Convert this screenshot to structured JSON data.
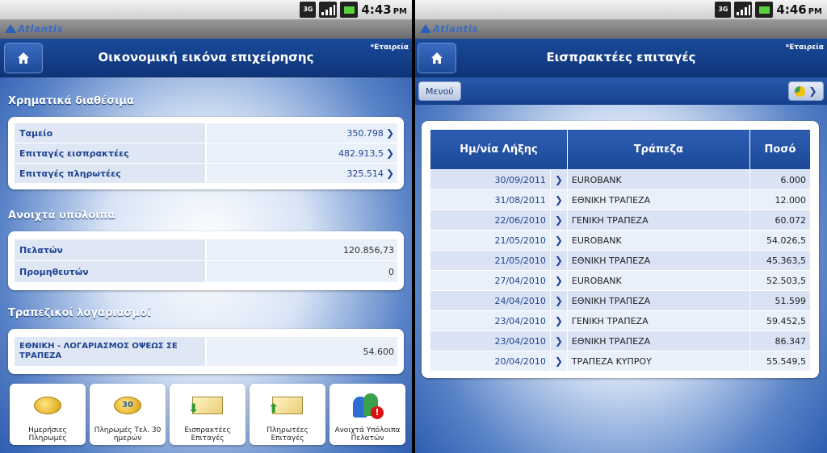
{
  "left": {
    "status": {
      "network": "3G",
      "time": "4:43",
      "ampm": "PM"
    },
    "logo": "Atlantis",
    "title": "Οικονομική εικόνα επιχείρησης",
    "company": "*Εταιρεία",
    "sections": {
      "cash": {
        "title": "Χρηματικά διαθέσιμα",
        "rows": [
          {
            "label": "Ταμείο",
            "value": "350.798"
          },
          {
            "label": "Επιταγές εισπρακτέες",
            "value": "482.913,5"
          },
          {
            "label": "Επιταγές πληρωτέες",
            "value": "325.514"
          }
        ]
      },
      "balances": {
        "title": "Ανοιχτά υπόλοιπα",
        "rows": [
          {
            "label": "Πελατών",
            "value": "120.856,73"
          },
          {
            "label": "Προμηθευτών",
            "value": "0"
          }
        ]
      },
      "bank": {
        "title": "Τραπεζικοί λογαριασμοί",
        "rows": [
          {
            "label": "ΕΘΝΙΚΗ - ΛΟΓΑΡΙΑΣΜΟΣ ΟΨΕΩΣ ΣΕ ΤΡΑΠΕΖΑ",
            "value": "54.600"
          }
        ]
      }
    },
    "tiles": [
      {
        "label": "Ημερήσιες Πληρωμές",
        "icon": "coins-icon"
      },
      {
        "label": "Πληρωμές Τελ. 30 ημερών",
        "icon": "coins-30-icon",
        "badge": "30"
      },
      {
        "label": "Εισπρακτέες Επιταγές",
        "icon": "cheque-in-icon"
      },
      {
        "label": "Πληρωτέες Επιταγές",
        "icon": "cheque-out-icon"
      },
      {
        "label": "Ανοιχτά Υπόλοιπα Πελατών",
        "icon": "customers-alert-icon"
      }
    ]
  },
  "right": {
    "status": {
      "network": "3G",
      "time": "4:46",
      "ampm": "PM"
    },
    "logo": "Atlantis",
    "title": "Εισπρακτέες επιταγές",
    "company": "*Εταιρεία",
    "menu_label": "Μενού",
    "table": {
      "headers": [
        "Ημ/νία Λήξης",
        "Τράπεζα",
        "Ποσό"
      ],
      "rows": [
        {
          "date": "30/09/2011",
          "bank": "EUROBANK",
          "amount": "6.000"
        },
        {
          "date": "31/08/2011",
          "bank": "ΕΘΝΙΚΗ ΤΡΑΠΕΖΑ",
          "amount": "12.000"
        },
        {
          "date": "22/06/2010",
          "bank": "ΓΕΝΙΚΗ ΤΡΑΠΕΖΑ",
          "amount": "60.072"
        },
        {
          "date": "21/05/2010",
          "bank": "EUROBANK",
          "amount": "54.026,5"
        },
        {
          "date": "21/05/2010",
          "bank": "ΕΘΝΙΚΗ ΤΡΑΠΕΖΑ",
          "amount": "45.363,5"
        },
        {
          "date": "27/04/2010",
          "bank": "EUROBANK",
          "amount": "52.503,5"
        },
        {
          "date": "24/04/2010",
          "bank": "ΕΘΝΙΚΗ ΤΡΑΠΕΖΑ",
          "amount": "51.599"
        },
        {
          "date": "23/04/2010",
          "bank": "ΓΕΝΙΚΗ ΤΡΑΠΕΖΑ",
          "amount": "59.452,5"
        },
        {
          "date": "23/04/2010",
          "bank": "ΕΘΝΙΚΗ ΤΡΑΠΕΖΑ",
          "amount": "86.347"
        },
        {
          "date": "20/04/2010",
          "bank": "ΤΡΑΠΕΖΑ ΚΥΠΡΟΥ",
          "amount": "55.549,5"
        }
      ]
    }
  }
}
